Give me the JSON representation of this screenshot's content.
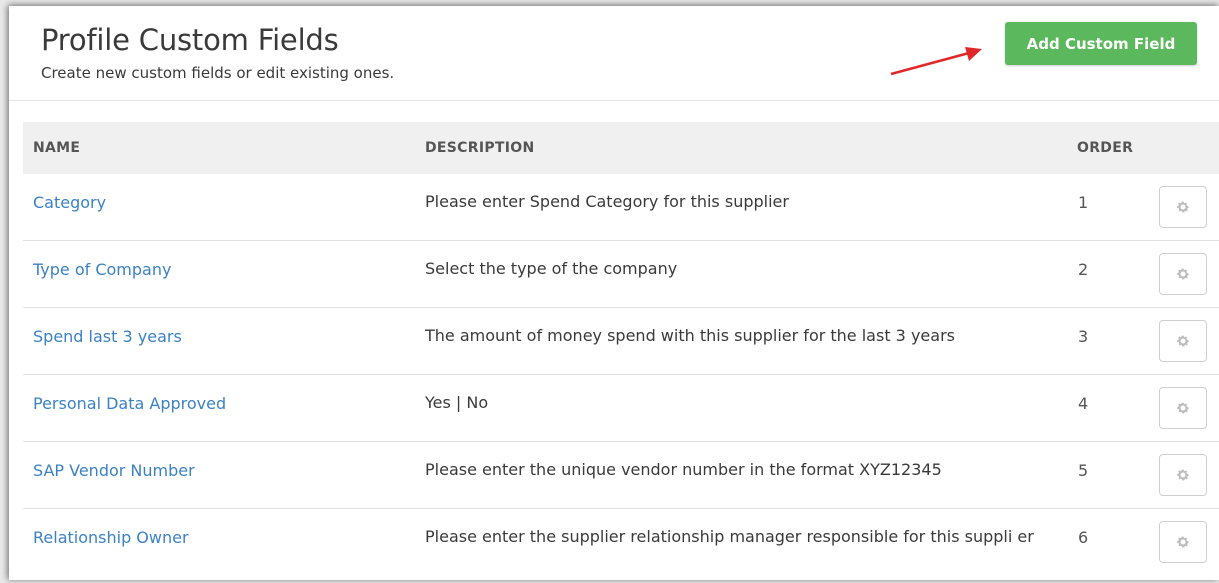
{
  "header": {
    "title": "Profile Custom Fields",
    "subtitle": "Create new custom fields or edit existing ones.",
    "add_button_label": "Add Custom Field"
  },
  "colors": {
    "accent_green": "#5cb85c",
    "link_blue": "#3b82c4",
    "annotation_arrow": "#e0282a"
  },
  "table": {
    "columns": [
      "NAME",
      "DESCRIPTION",
      "ORDER"
    ],
    "rows": [
      {
        "name": "Category",
        "description": "Please enter Spend Category for this supplier",
        "order": "1"
      },
      {
        "name": "Type of Company",
        "description": "Select the type of the company",
        "order": "2"
      },
      {
        "name": "Spend last 3 years",
        "description": "The amount of money spend with this supplier for the last 3 years",
        "order": "3"
      },
      {
        "name": "Personal Data Approved",
        "description": "Yes | No",
        "order": "4"
      },
      {
        "name": "SAP Vendor Number",
        "description": "Please enter the unique vendor number in the format XYZ12345",
        "order": "5"
      },
      {
        "name": "Relationship Owner",
        "description": "Please enter the supplier relationship manager responsible for this suppli er",
        "order": "6"
      }
    ],
    "row_action_icon": "gear-icon"
  }
}
